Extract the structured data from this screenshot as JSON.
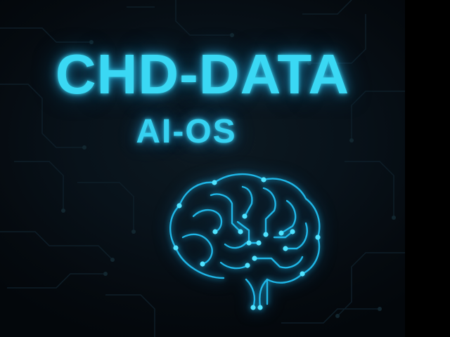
{
  "title": "CHD-DATA",
  "subtitle": "AI-OS",
  "graphic": {
    "icon": "circuit-brain-icon",
    "background": "circuit-board-pattern"
  },
  "colors": {
    "accent": "#3ad8f4",
    "trace": "#1fb6e6",
    "node": "#4fe3ff",
    "background": "#050a0f",
    "background_circuit": "#0e1e28"
  }
}
